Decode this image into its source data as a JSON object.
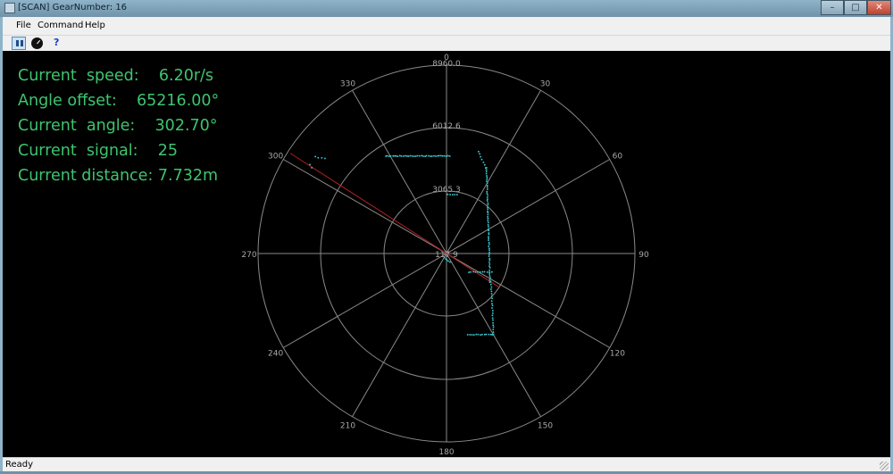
{
  "window": {
    "title": "[SCAN] GearNumber: 16",
    "minimize": "–",
    "maximize": "□",
    "close": "✕"
  },
  "menu": {
    "items": [
      "File",
      "Command",
      "Help"
    ]
  },
  "toolbar": {
    "pause_icon": "pause-icon",
    "radar_icon": "radar-icon",
    "help_label": "?"
  },
  "readout": {
    "speed": "Current  speed:    6.20r/s",
    "offset": "Angle offset:    65216.00°",
    "angle": "Current  angle:    302.70°",
    "signal": "Current  signal:    25",
    "distance": "Current distance: 7.732m"
  },
  "polar": {
    "ring_labels": [
      "8960.0",
      "6012.6",
      "3065.3",
      "117.9"
    ],
    "angle_labels": [
      "0",
      "30",
      "60",
      "90",
      "120",
      "150",
      "180",
      "210",
      "240",
      "270",
      "300",
      "330"
    ],
    "colors": {
      "grid": "#8a8a8a",
      "points": "#3ed0d8",
      "beam": "#b02020",
      "text": "#a8a8a8",
      "readout": "#3fc46e"
    },
    "beam_angle": 302.7
  },
  "status": {
    "text": "Ready"
  }
}
